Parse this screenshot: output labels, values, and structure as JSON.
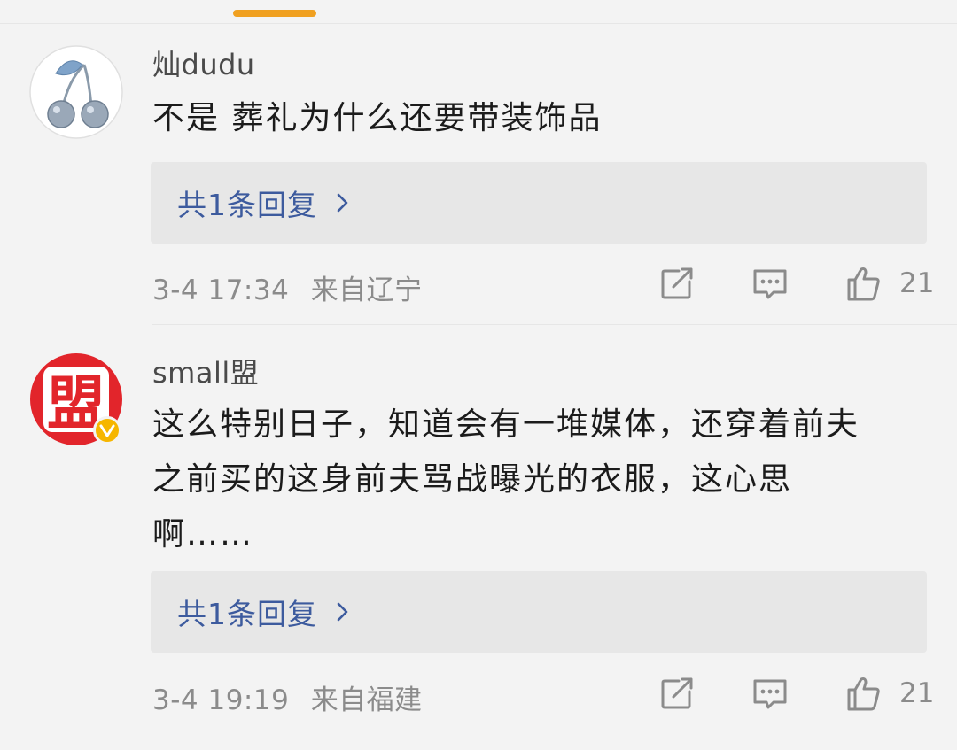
{
  "colors": {
    "background": "#f3f3f3",
    "accent_indicator": "#f0a020",
    "link_blue": "#3d5b9e",
    "meta_gray": "#8b8b8b",
    "reply_box": "#e7e7e7",
    "verified_gold": "#f6b600",
    "avatar_red": "#e2252b"
  },
  "comments": [
    {
      "username": "灿dudu",
      "avatar_icon": "cherry-avatar-icon",
      "text": "不是 葬礼为什么还要带装饰品",
      "reply_link": "共1条回复",
      "time": "3-4 17:34",
      "location": "来自辽宁",
      "like_count": "21"
    },
    {
      "username": "small盟",
      "avatar_char": "盟",
      "verified": true,
      "text": "这么特别日子，知道会有一堆媒体，还穿着前夫之前买的这身前夫骂战曝光的衣服，这心思啊……",
      "reply_link": "共1条回复",
      "time": "3-4 19:19",
      "location": "来自福建",
      "like_count": "21"
    }
  ]
}
